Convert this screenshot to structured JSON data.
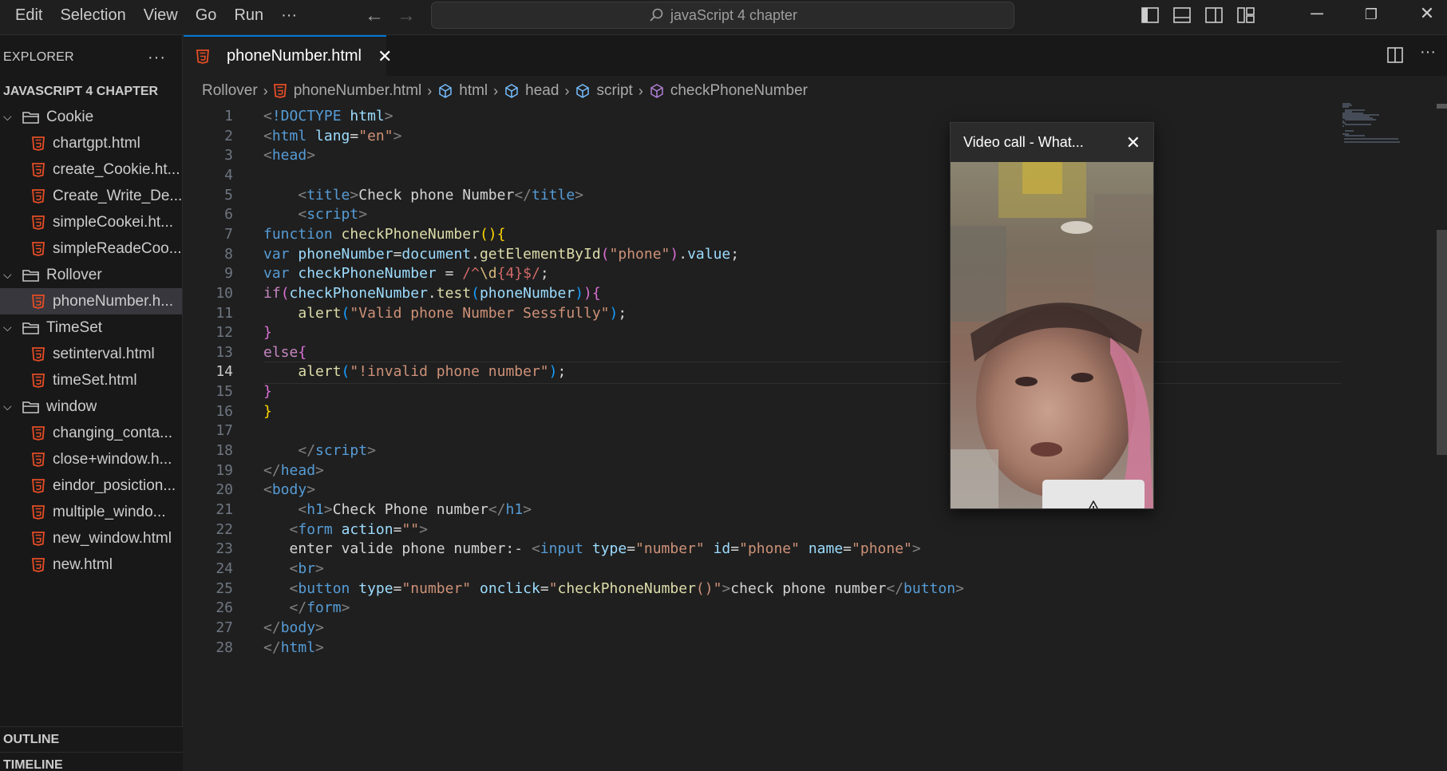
{
  "menu": {
    "items": [
      "Edit",
      "Selection",
      "View",
      "Go",
      "Run"
    ],
    "more": "···"
  },
  "command_center": {
    "text": "javaScript 4 chapter",
    "icon": "search-icon"
  },
  "sidebar": {
    "title": "EXPLORER",
    "more": "···",
    "project": "JAVASCRIPT 4 CHAPTER",
    "tree": [
      {
        "type": "folder",
        "label": "Cookie"
      },
      {
        "type": "file",
        "label": "chartgpt.html"
      },
      {
        "type": "file",
        "label": "create_Cookie.ht..."
      },
      {
        "type": "file",
        "label": "Create_Write_De..."
      },
      {
        "type": "file",
        "label": "simpleCookei.ht..."
      },
      {
        "type": "file",
        "label": "simpleReadeCoo..."
      },
      {
        "type": "folder",
        "label": "Rollover"
      },
      {
        "type": "file",
        "label": "phoneNumber.h...",
        "selected": true
      },
      {
        "type": "folder",
        "label": "TimeSet"
      },
      {
        "type": "file",
        "label": "setinterval.html"
      },
      {
        "type": "file",
        "label": "timeSet.html"
      },
      {
        "type": "folder",
        "label": "window"
      },
      {
        "type": "file",
        "label": "changing_conta..."
      },
      {
        "type": "file",
        "label": "close+window.h..."
      },
      {
        "type": "file",
        "label": "eindor_posiction..."
      },
      {
        "type": "file",
        "label": "multiple_windo..."
      },
      {
        "type": "file",
        "label": "new_window.html"
      },
      {
        "type": "file",
        "label": "new.html"
      }
    ],
    "outline": "OUTLINE",
    "timeline": "TIMELINE"
  },
  "editor": {
    "tab_label": "phoneNumber.html",
    "breadcrumbs": {
      "folder": "Rollover",
      "file": "phoneNumber.html",
      "html": "html",
      "head": "head",
      "script": "script",
      "function": "checkPhoneNumber"
    },
    "active_line": 14,
    "lines": [
      [
        [
          "t-br",
          "<"
        ],
        [
          "t-dt",
          "!DOCTYPE "
        ],
        [
          "t-attr",
          "html"
        ],
        [
          "t-br",
          ">"
        ]
      ],
      [
        [
          "t-br",
          "<"
        ],
        [
          "t-tag",
          "html"
        ],
        [
          "t-text",
          " "
        ],
        [
          "t-attr",
          "lang"
        ],
        [
          "t-text",
          "="
        ],
        [
          "t-str",
          "\"en\""
        ],
        [
          "t-br",
          ">"
        ]
      ],
      [
        [
          "t-br",
          "<"
        ],
        [
          "t-tag",
          "head"
        ],
        [
          "t-br",
          ">"
        ]
      ],
      [],
      [
        [
          "t-text",
          "    "
        ],
        [
          "t-br",
          "<"
        ],
        [
          "t-tag",
          "title"
        ],
        [
          "t-br",
          ">"
        ],
        [
          "t-text",
          "Check phone Number"
        ],
        [
          "t-br",
          "</"
        ],
        [
          "t-tag",
          "title"
        ],
        [
          "t-br",
          ">"
        ]
      ],
      [
        [
          "t-text",
          "    "
        ],
        [
          "t-br",
          "<"
        ],
        [
          "t-tag",
          "script"
        ],
        [
          "t-br",
          ">"
        ]
      ],
      [
        [
          "t-kw",
          "function"
        ],
        [
          "t-text",
          " "
        ],
        [
          "t-fn",
          "checkPhoneNumber"
        ],
        [
          "t-p1",
          "(){"
        ]
      ],
      [
        [
          "t-kw",
          "var"
        ],
        [
          "t-text",
          " "
        ],
        [
          "t-var",
          "phoneNumber"
        ],
        [
          "t-text",
          "="
        ],
        [
          "t-var",
          "document"
        ],
        [
          "t-text",
          "."
        ],
        [
          "t-fn",
          "getElementById"
        ],
        [
          "t-p2",
          "("
        ],
        [
          "t-str",
          "\"phone\""
        ],
        [
          "t-p2",
          ")"
        ],
        [
          "t-text",
          "."
        ],
        [
          "t-var",
          "value"
        ],
        [
          "t-text",
          ";"
        ]
      ],
      [
        [
          "t-kw",
          "var"
        ],
        [
          "t-text",
          " "
        ],
        [
          "t-var",
          "checkPhoneNumber"
        ],
        [
          "t-text",
          " = "
        ],
        [
          "t-re",
          "/^"
        ],
        [
          "t-rx2",
          "\\d"
        ],
        [
          "t-re",
          "{4}"
        ],
        [
          "t-re",
          "$/"
        ],
        [
          "t-text",
          ";"
        ]
      ],
      [
        [
          "t-ctl",
          "if"
        ],
        [
          "t-p2",
          "("
        ],
        [
          "t-var",
          "checkPhoneNumber"
        ],
        [
          "t-text",
          "."
        ],
        [
          "t-fn",
          "test"
        ],
        [
          "t-p3",
          "("
        ],
        [
          "t-var",
          "phoneNumber"
        ],
        [
          "t-p3",
          ")"
        ],
        [
          "t-p2",
          ")"
        ],
        [
          "t-p2",
          "{"
        ]
      ],
      [
        [
          "t-text",
          "    "
        ],
        [
          "t-fn",
          "alert"
        ],
        [
          "t-p3",
          "("
        ],
        [
          "t-str",
          "\"Valid phone Number Sessfully\""
        ],
        [
          "t-p3",
          ")"
        ],
        [
          "t-text",
          ";"
        ]
      ],
      [
        [
          "t-p2",
          "}"
        ]
      ],
      [
        [
          "t-ctl",
          "else"
        ],
        [
          "t-p2",
          "{"
        ]
      ],
      [
        [
          "t-text",
          "    "
        ],
        [
          "t-fn",
          "alert"
        ],
        [
          "t-p3",
          "("
        ],
        [
          "t-str",
          "\"!invalid phone number\""
        ],
        [
          "t-p3",
          ")"
        ],
        [
          "t-text",
          ";"
        ]
      ],
      [
        [
          "t-p2",
          "}"
        ]
      ],
      [
        [
          "t-p1",
          "}"
        ]
      ],
      [],
      [
        [
          "t-text",
          "    "
        ],
        [
          "t-br",
          "</"
        ],
        [
          "t-tag",
          "script"
        ],
        [
          "t-br",
          ">"
        ]
      ],
      [
        [
          "t-br",
          "</"
        ],
        [
          "t-tag",
          "head"
        ],
        [
          "t-br",
          ">"
        ]
      ],
      [
        [
          "t-br",
          "<"
        ],
        [
          "t-tag",
          "body"
        ],
        [
          "t-br",
          ">"
        ]
      ],
      [
        [
          "t-text",
          "    "
        ],
        [
          "t-br",
          "<"
        ],
        [
          "t-tag",
          "h1"
        ],
        [
          "t-br",
          ">"
        ],
        [
          "t-text",
          "Check Phone number"
        ],
        [
          "t-br",
          "</"
        ],
        [
          "t-tag",
          "h1"
        ],
        [
          "t-br",
          ">"
        ]
      ],
      [
        [
          "t-text",
          "   "
        ],
        [
          "t-br",
          "<"
        ],
        [
          "t-tag",
          "form"
        ],
        [
          "t-text",
          " "
        ],
        [
          "t-attr",
          "action"
        ],
        [
          "t-text",
          "="
        ],
        [
          "t-str",
          "\"\""
        ],
        [
          "t-br",
          ">"
        ]
      ],
      [
        [
          "t-text",
          "   enter valide phone number:- "
        ],
        [
          "t-br",
          "<"
        ],
        [
          "t-tag",
          "input"
        ],
        [
          "t-text",
          " "
        ],
        [
          "t-attr",
          "type"
        ],
        [
          "t-text",
          "="
        ],
        [
          "t-str",
          "\"number\""
        ],
        [
          "t-text",
          " "
        ],
        [
          "t-attr",
          "id"
        ],
        [
          "t-text",
          "="
        ],
        [
          "t-str",
          "\"phone\""
        ],
        [
          "t-text",
          " "
        ],
        [
          "t-attr",
          "name"
        ],
        [
          "t-text",
          "="
        ],
        [
          "t-str",
          "\"phone\""
        ],
        [
          "t-br",
          ">"
        ]
      ],
      [
        [
          "t-text",
          "   "
        ],
        [
          "t-br",
          "<"
        ],
        [
          "t-tag",
          "br"
        ],
        [
          "t-br",
          ">"
        ]
      ],
      [
        [
          "t-text",
          "   "
        ],
        [
          "t-br",
          "<"
        ],
        [
          "t-tag",
          "button"
        ],
        [
          "t-text",
          " "
        ],
        [
          "t-attr",
          "type"
        ],
        [
          "t-text",
          "="
        ],
        [
          "t-str",
          "\"number\""
        ],
        [
          "t-text",
          " "
        ],
        [
          "t-attr",
          "onclick"
        ],
        [
          "t-text",
          "="
        ],
        [
          "t-str",
          "\""
        ],
        [
          "t-fn",
          "checkPhoneNumber"
        ],
        [
          "t-str",
          "()\""
        ],
        [
          "t-br",
          ">"
        ],
        [
          "t-text",
          "check phone number"
        ],
        [
          "t-br",
          "</"
        ],
        [
          "t-tag",
          "button"
        ],
        [
          "t-br",
          ">"
        ]
      ],
      [
        [
          "t-text",
          "   "
        ],
        [
          "t-br",
          "</"
        ],
        [
          "t-tag",
          "form"
        ],
        [
          "t-br",
          ">"
        ]
      ],
      [
        [
          "t-br",
          "</"
        ],
        [
          "t-tag",
          "body"
        ],
        [
          "t-br",
          ">"
        ]
      ],
      [
        [
          "t-br",
          "</"
        ],
        [
          "t-tag",
          "html"
        ],
        [
          "t-br",
          ">"
        ]
      ]
    ]
  },
  "video_call": {
    "title": "Video call - What...",
    "warning_icon": "warning-icon"
  },
  "colors": {
    "accent": "#0078d4",
    "html_icon": "#e44d26",
    "folder_icon": "#c5c5c5"
  }
}
